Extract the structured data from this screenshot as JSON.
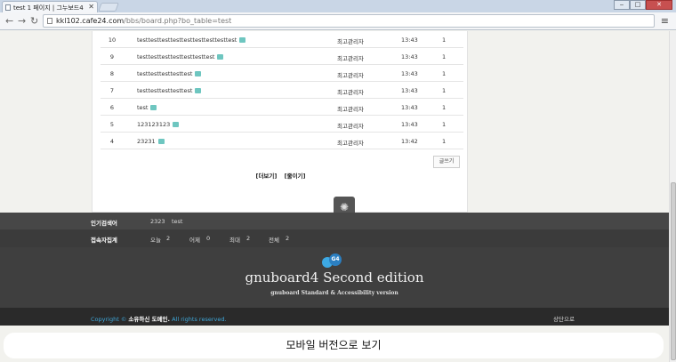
{
  "browser": {
    "tab_title": "test 1 페이지 | 그누보드4",
    "url_host": "kkl102.cafe24.com",
    "url_path": "/bbs/board.php?bo_table=test",
    "controls": {
      "minimize": "‒",
      "maximize": "□",
      "close": "✕"
    }
  },
  "board": {
    "rows": [
      {
        "num": "10",
        "subject": "testtesttesttesttesttesttesttesttest",
        "author": "최고관리자",
        "date": "13:43",
        "hits": "1"
      },
      {
        "num": "9",
        "subject": "testtesttesttesttesttesttest",
        "author": "최고관리자",
        "date": "13:43",
        "hits": "1"
      },
      {
        "num": "8",
        "subject": "testtesttesttesttest",
        "author": "최고관리자",
        "date": "13:43",
        "hits": "1"
      },
      {
        "num": "7",
        "subject": "testtesttesttesttest",
        "author": "최고관리자",
        "date": "13:43",
        "hits": "1"
      },
      {
        "num": "6",
        "subject": "test",
        "author": "최고관리자",
        "date": "13:43",
        "hits": "1"
      },
      {
        "num": "5",
        "subject": "123123123",
        "author": "최고관리자",
        "date": "13:43",
        "hits": "1"
      },
      {
        "num": "4",
        "subject": "23231",
        "author": "최고관리자",
        "date": "13:42",
        "hits": "1"
      }
    ],
    "write_label": "글쓰기",
    "more_label": "[더보기]",
    "less_label": "[줄이기]"
  },
  "popular": {
    "label": "인기검색어",
    "terms": [
      "2323",
      "test"
    ]
  },
  "visitors": {
    "label": "접속자집계",
    "today_label": "오늘",
    "today": "2",
    "yesterday_label": "어제",
    "yesterday": "0",
    "max_label": "최대",
    "max": "2",
    "total_label": "전체",
    "total": "2"
  },
  "brand": {
    "logo_text": "G4",
    "title": "gnuboard4 Second edition",
    "subtitle": "gnuboard Standard & Accessibility version"
  },
  "footer": {
    "copyright_prefix": "Copyright ©",
    "owner": "소유하신 도메인.",
    "rights": "All rights reserved.",
    "to_top": "상단으로"
  },
  "mobile": {
    "label": "모바일 버전으로 보기"
  },
  "colors": {
    "comment_icon": "#6ec6c0",
    "copyright_link": "#3fa7d9",
    "footer_dark": "#2a2a2a"
  }
}
